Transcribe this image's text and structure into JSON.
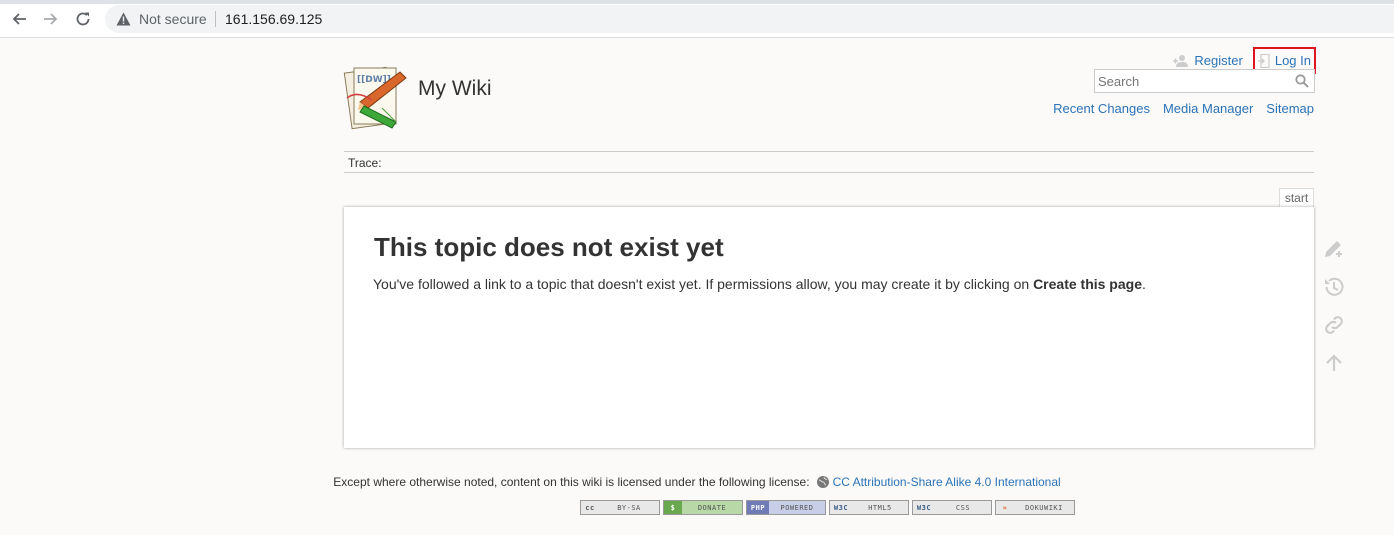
{
  "browser": {
    "security_label": "Not secure",
    "url": "161.156.69.125",
    "icons": [
      "back-arrow-icon",
      "forward-arrow-icon",
      "reload-icon",
      "warning-icon"
    ]
  },
  "user_tools": {
    "register": "Register",
    "login": "Log In"
  },
  "site": {
    "title": "My Wiki",
    "logo_text": "[[DW]]"
  },
  "search": {
    "placeholder": "Search"
  },
  "site_tools": {
    "recent_changes": "Recent Changes",
    "media_manager": "Media Manager",
    "sitemap": "Sitemap"
  },
  "trace": {
    "label": "Trace:"
  },
  "page": {
    "tab": "start",
    "heading": "This topic does not exist yet",
    "body_prefix": "You've followed a link to a topic that doesn't exist yet. If permissions allow, you may create it by clicking on ",
    "body_bold": "Create this page",
    "body_suffix": "."
  },
  "page_tools": [
    "edit-icon",
    "revisions-icon",
    "backlinks-icon",
    "back-to-top-icon"
  ],
  "footer": {
    "license_text": "Except where otherwise noted, content on this wiki is licensed under the following license:",
    "license_link": "CC Attribution-Share Alike 4.0 International",
    "badges": [
      {
        "left": "cc",
        "right": "BY-SA"
      },
      {
        "left": "$",
        "right": "DONATE"
      },
      {
        "left": "PHP",
        "right": "POWERED"
      },
      {
        "left": "W3C",
        "right": "HTML5"
      },
      {
        "left": "W3C",
        "right": "CSS"
      },
      {
        "left": "»",
        "right": "DOKUWIKI"
      }
    ]
  },
  "colors": {
    "link": "#2b73b7",
    "highlight_border": "#e0141e",
    "background": "#fbfaf9"
  }
}
